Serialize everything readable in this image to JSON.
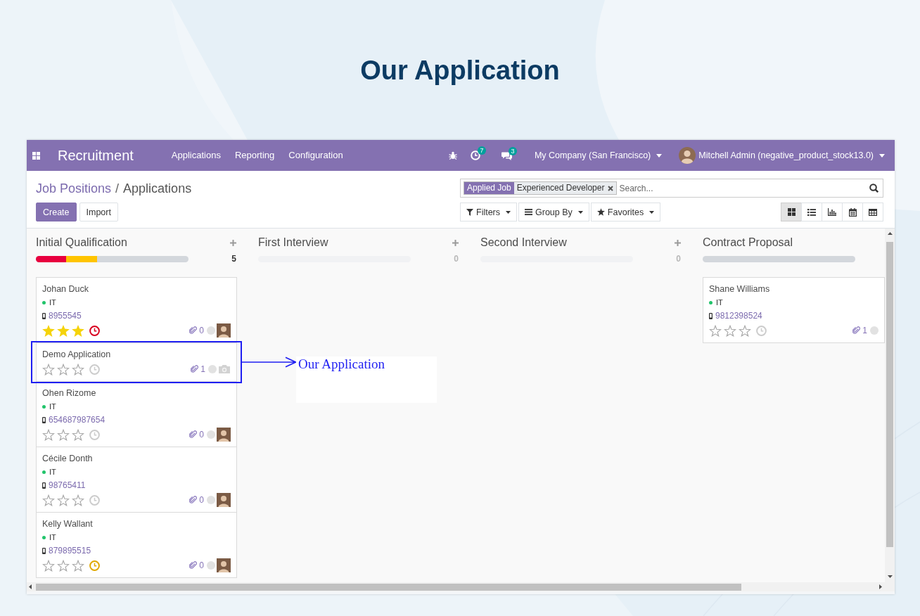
{
  "page_title": "Our Application",
  "navbar": {
    "app_name": "Recruitment",
    "menu": [
      {
        "label": "Applications"
      },
      {
        "label": "Reporting"
      },
      {
        "label": "Configuration"
      }
    ],
    "activity_count": "7",
    "message_count": "3",
    "company": "My Company (San Francisco)",
    "user": "Mitchell Admin (negative_product_stock13.0)"
  },
  "breadcrumbs": [
    {
      "label": "Job Positions"
    },
    {
      "label": "Applications"
    }
  ],
  "breadcrumb_separator": "/",
  "buttons": [
    {
      "label": "Create",
      "kind": "primary"
    },
    {
      "label": "Import",
      "kind": "secondary"
    }
  ],
  "search": {
    "facets": [
      {
        "field": "Applied Job",
        "value": "Experienced Developer"
      }
    ],
    "placeholder": "Search..."
  },
  "search_options": [
    {
      "kind": "filter",
      "label": "Filters"
    },
    {
      "kind": "group_by",
      "label": "Group By"
    },
    {
      "kind": "favorites",
      "label": "Favorites"
    }
  ],
  "views": [
    {
      "kind": "kanban",
      "selected": true
    },
    {
      "kind": "list",
      "selected": false
    },
    {
      "kind": "graph",
      "selected": false
    },
    {
      "kind": "calendar",
      "selected": false
    },
    {
      "kind": "pivot",
      "selected": false
    }
  ],
  "columns": [
    {
      "title": "Initial Qualification",
      "add_button": true,
      "count": "5",
      "empty": false,
      "progress": [
        {
          "color": "#e8003f",
          "level": 0.2
        },
        {
          "color": "#ffc400",
          "level": 0.2
        }
      ],
      "cards": [
        {
          "name": "Johan Duck",
          "tag": "IT",
          "phone": "8955545",
          "stars": 3,
          "activity": {
            "color": "#d8001f"
          },
          "attachments": "0",
          "photo": true
        },
        {
          "name": "Demo Application",
          "stars": 0,
          "activity": {
            "color": "#cccccc"
          },
          "attachments": "1",
          "photo": false
        },
        {
          "name": "Ohen Rizome",
          "tag": "IT",
          "phone": "654687987654",
          "stars": 0,
          "activity": {
            "color": "#cccccc"
          },
          "attachments": "0",
          "photo": true
        },
        {
          "name": "Cécile Donth",
          "tag": "IT",
          "phone": "98765411",
          "stars": 0,
          "activity": {
            "color": "#cccccc"
          },
          "attachments": "0",
          "photo": true
        },
        {
          "name": "Kelly Wallant",
          "tag": "IT",
          "phone": "879895515",
          "stars": 0,
          "activity": {
            "color": "#e0a800"
          },
          "attachments": "0",
          "photo": true
        }
      ]
    },
    {
      "title": "First Interview",
      "add_button": true,
      "count": "0",
      "empty": true
    },
    {
      "title": "Second Interview",
      "add_button": true,
      "count": "0",
      "empty": true
    },
    {
      "title": "Contract Proposal",
      "add_button": false,
      "empty": false,
      "cards": [
        {
          "name": "Shane Williams",
          "tag": "IT",
          "phone": "9812398524",
          "stars": 0,
          "activity": {
            "color": "#cccccc"
          },
          "attachments": "1"
        }
      ]
    }
  ],
  "annotation": {
    "label": "Our Application"
  }
}
